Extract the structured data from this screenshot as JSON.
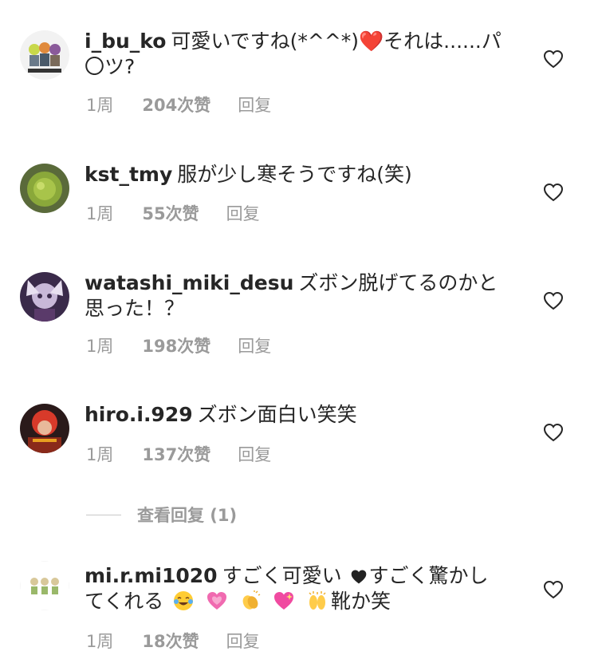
{
  "comments": [
    {
      "username": "i_bu_ko",
      "text": "可愛いですね(*^^*)❤️それは......パ〇ツ?",
      "time": "1周",
      "likes": "204次赞",
      "reply": "回复"
    },
    {
      "username": "kst_tmy",
      "text": "服が少し寒そうですね(笑)",
      "time": "1周",
      "likes": "55次赞",
      "reply": "回复"
    },
    {
      "username": "watashi_miki_desu",
      "text": "ズボン脱げてるのかと思った！？",
      "time": "1周",
      "likes": "198次赞",
      "reply": "回复"
    },
    {
      "username": "hiro.i.929",
      "text": "ズボン面白い笑笑",
      "time": "1周",
      "likes": "137次赞",
      "reply": "回复",
      "view_replies": "查看回复 (1)"
    },
    {
      "username": "mi.r.mi1020",
      "text_part1": "すごく可愛い",
      "text_part2": "すごく驚かしてくれる",
      "text_part3": "靴か笑",
      "time": "1周",
      "likes": "18次赞",
      "reply": "回复"
    }
  ],
  "icons": {
    "like": "heart-outline-icon",
    "emojis": [
      "tears-of-joy",
      "growing-heart",
      "clapping-hands",
      "sparkling-heart",
      "raising-hands"
    ]
  },
  "colors": {
    "text": "#262626",
    "meta": "#9a9a9a",
    "heart_red": "#ed1c24"
  }
}
